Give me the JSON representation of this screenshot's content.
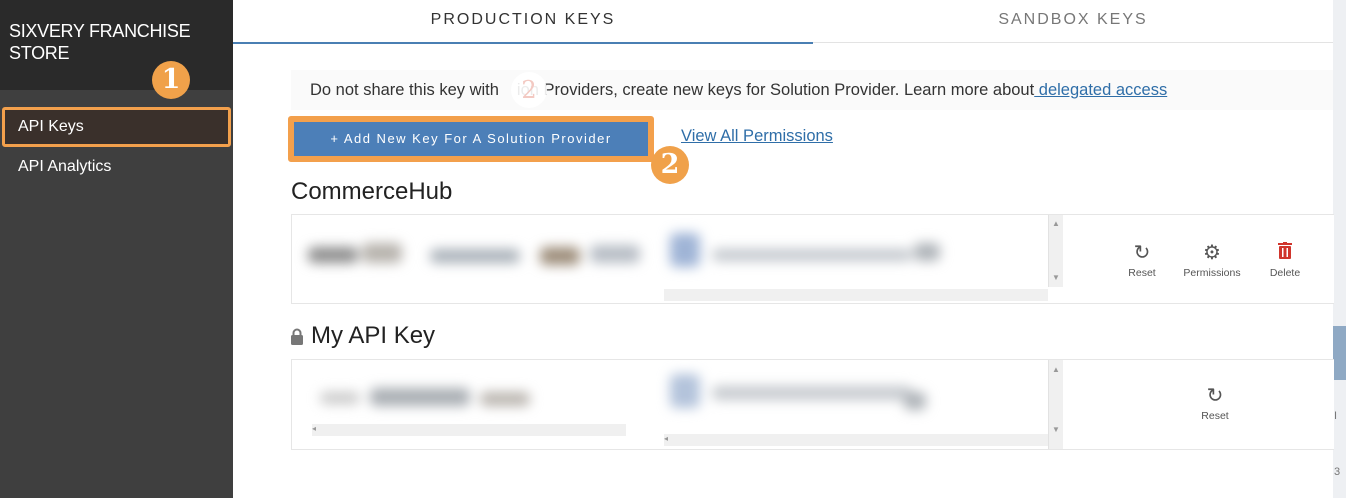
{
  "sidebar": {
    "brand": "SIXVERY FRANCHISE STORE",
    "items": [
      {
        "label": "API Keys"
      },
      {
        "label": "API Analytics"
      }
    ]
  },
  "badges": {
    "one": "1",
    "two": "2"
  },
  "tabs": [
    {
      "label": "PRODUCTION KEYS"
    },
    {
      "label": "SANDBOX KEYS"
    }
  ],
  "notice": {
    "text": "Do not share this key with",
    "text_after": "ion Providers, create new keys for Solution Provider. Learn more about",
    "link": " delegated access"
  },
  "add_button_label": "+ Add New Key For A Solution Provider",
  "permissions_link": "View All Permissions",
  "keys": [
    {
      "title": "CommerceHub",
      "actions": {
        "reset": "Reset",
        "permissions": "Permissions",
        "delete": "Delete"
      }
    },
    {
      "title": "My API Key",
      "actions": {
        "reset": "Reset"
      }
    }
  ],
  "colors": {
    "accent_orange": "#f3a04c",
    "button_blue": "#4c7fb8",
    "link_blue": "#2f6ea8",
    "sidebar": "#3f3f3f",
    "delete_red": "#d0352c"
  },
  "icons": [
    "reset-icon",
    "gear-icon",
    "trash-icon",
    "lock-icon"
  ]
}
